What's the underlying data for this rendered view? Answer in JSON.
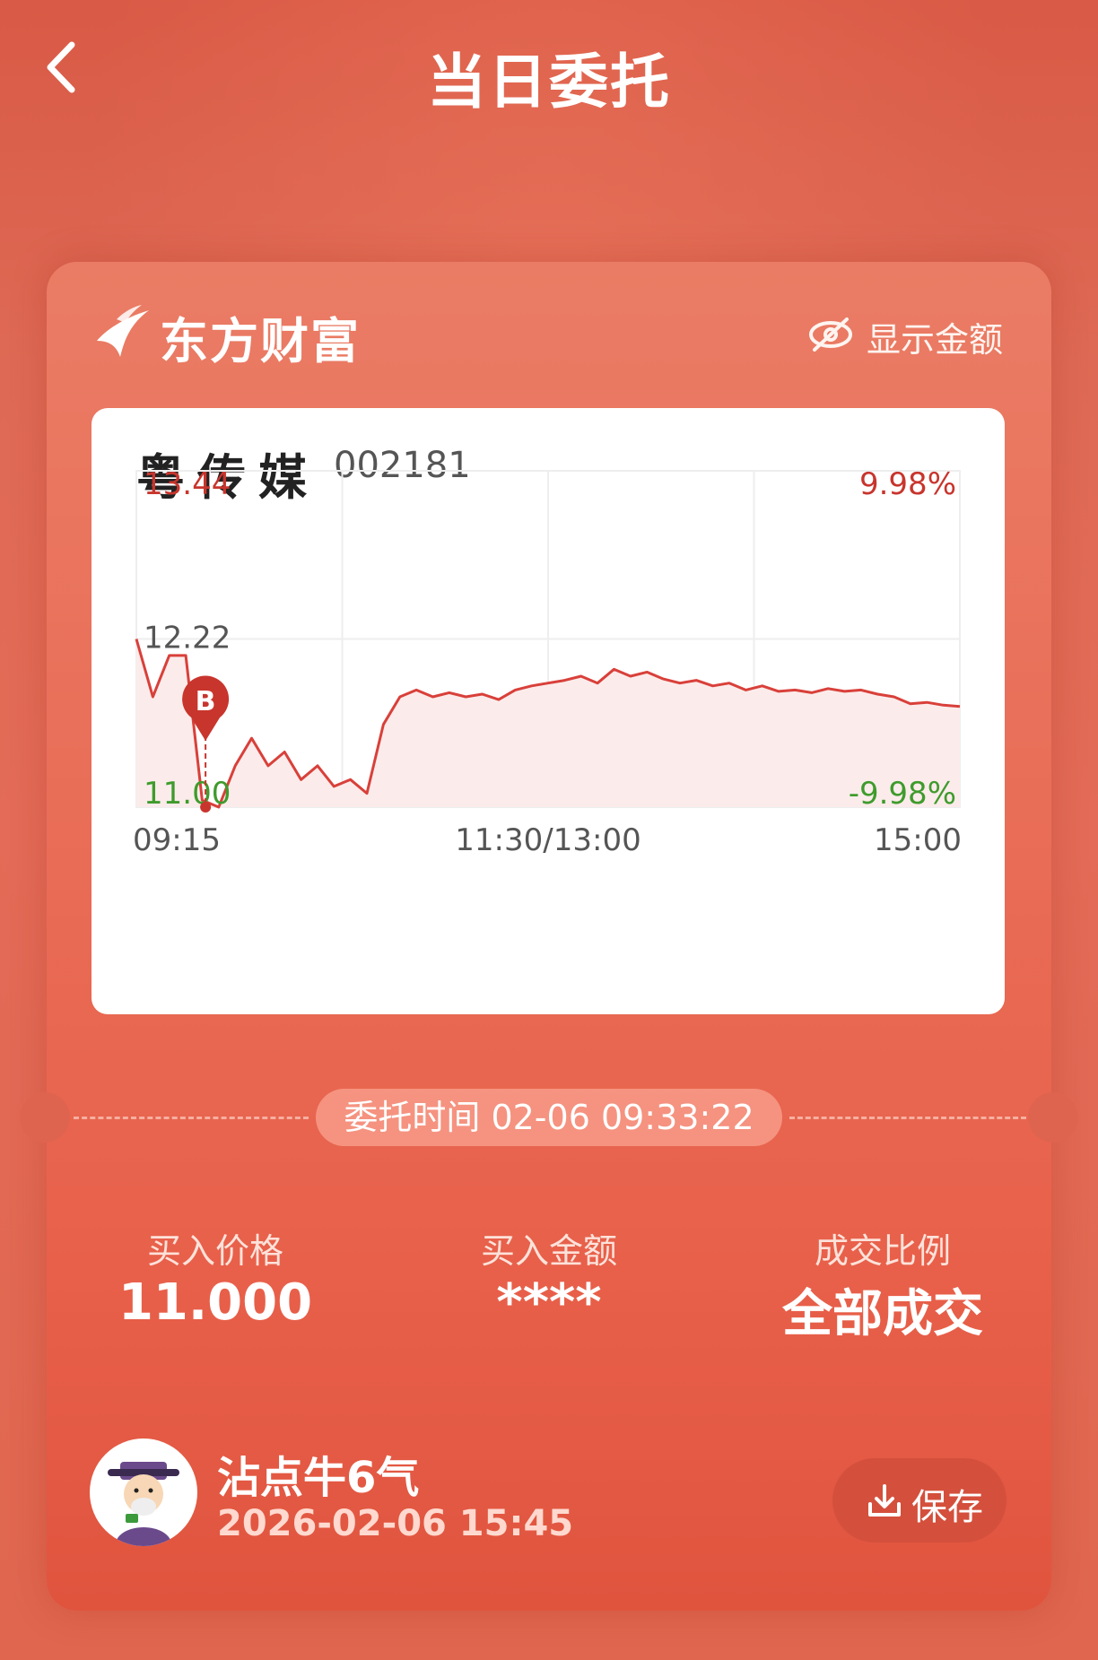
{
  "header": {
    "title": "当日委托"
  },
  "brand": {
    "name": "东方财富"
  },
  "show_amount": {
    "label": "显示金额"
  },
  "stock": {
    "name": "粤传媒",
    "code": "002181"
  },
  "chart_data": {
    "type": "line",
    "x_ticks": [
      "09:15",
      "11:30/13:00",
      "15:00"
    ],
    "y_left_ticks": [
      "13.44",
      "12.22",
      "11.00"
    ],
    "y_right_ticks": [
      "9.98%",
      "-9.98%"
    ],
    "ylim": [
      11.0,
      13.44
    ],
    "x": [
      0,
      1,
      2,
      3,
      4,
      5,
      6,
      7,
      8,
      9,
      10,
      11,
      12,
      13,
      14,
      15,
      16,
      17,
      18,
      19,
      20,
      21,
      22,
      23,
      24,
      25,
      26,
      27,
      28,
      29,
      30,
      31,
      32,
      33,
      34,
      35,
      36,
      37,
      38,
      39,
      40,
      41,
      42,
      43,
      44,
      45,
      46,
      47,
      48,
      49,
      50
    ],
    "values": [
      12.22,
      11.8,
      12.1,
      12.1,
      11.05,
      11.0,
      11.3,
      11.5,
      11.3,
      11.4,
      11.2,
      11.3,
      11.15,
      11.2,
      11.1,
      11.6,
      11.8,
      11.85,
      11.8,
      11.83,
      11.8,
      11.82,
      11.78,
      11.85,
      11.88,
      11.9,
      11.92,
      11.95,
      11.9,
      12.0,
      11.95,
      11.98,
      11.93,
      11.9,
      11.92,
      11.88,
      11.9,
      11.85,
      11.88,
      11.84,
      11.85,
      11.83,
      11.86,
      11.84,
      11.85,
      11.82,
      11.8,
      11.75,
      11.76,
      11.74,
      11.73
    ],
    "buy_marker": {
      "label": "B",
      "price": 11.0,
      "x": 4.2
    },
    "colors": {
      "line": "#d9403a",
      "fill": "#fbeceb",
      "up": "#c8352d",
      "down": "#3f9b2c",
      "grid": "#eeeeee"
    }
  },
  "order": {
    "time_label": "委托时间 02-06 09:33:22"
  },
  "stats": [
    {
      "label": "买入价格",
      "value": "11.000"
    },
    {
      "label": "买入金额",
      "value": "****"
    },
    {
      "label": "成交比例",
      "value": "全部成交"
    }
  ],
  "user": {
    "name": "沾点牛6气",
    "date": "2026-02-06 15:45"
  },
  "save": {
    "label": "保存"
  },
  "colors": {
    "accent": "#e8604a",
    "white": "#ffffff"
  }
}
